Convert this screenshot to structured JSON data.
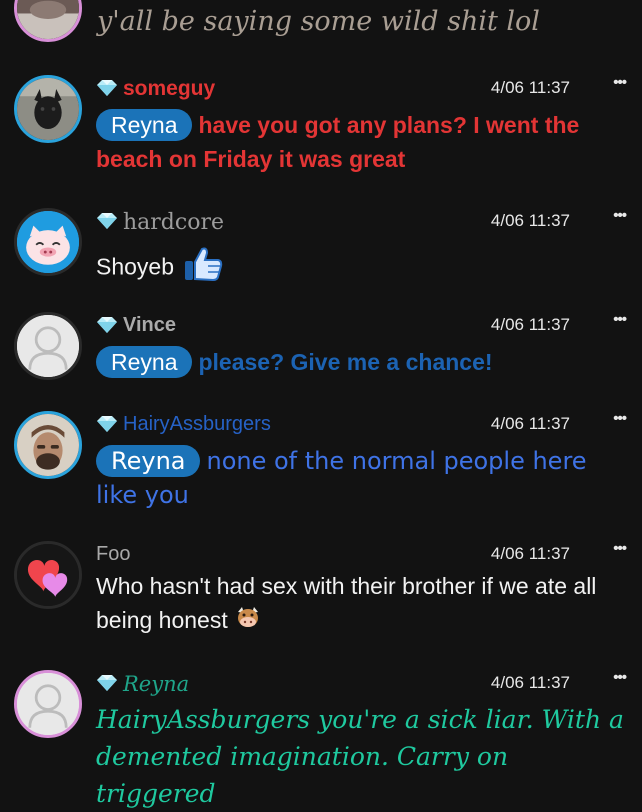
{
  "messages": [
    {
      "id": "prev",
      "text": "y'all be saying some wild shit lol"
    },
    {
      "id": "someguy",
      "username": "someguy",
      "timestamp": "4/06 11:37",
      "mention": "Reyna",
      "text": "have you got any plans? I went the beach on Friday it was great",
      "colors": {
        "name": "#e33535",
        "text": "#e33535"
      }
    },
    {
      "id": "hardcore",
      "username": "hardcore",
      "timestamp": "4/06 11:37",
      "text": "Shoyeb",
      "emoji": "thumbs-up-icon"
    },
    {
      "id": "vince",
      "username": "Vince",
      "timestamp": "4/06 11:37",
      "mention": "Reyna",
      "text": "please? Give me a chance!",
      "colors": {
        "name": "#aaaaaa",
        "text": "#1c63b3"
      }
    },
    {
      "id": "hairy",
      "username": "HairyAssburgers",
      "timestamp": "4/06 11:37",
      "mention": "Reyna",
      "text": "none of the normal people here like you",
      "colors": {
        "name": "#1e56b8",
        "text": "#3f73e6"
      }
    },
    {
      "id": "foo",
      "username": "Foo",
      "timestamp": "4/06 11:37",
      "text": "Who hasn't had sex with their brother if we ate all being honest",
      "emoji": "cow-face-icon"
    },
    {
      "id": "reyna",
      "username": "Reyna",
      "timestamp": "4/06 11:37",
      "text": "HairyAssburgers you're a sick liar. With a demented imagination. Carry on triggered",
      "colors": {
        "name": "#1fa58a",
        "text": "#1fc99f"
      }
    }
  ],
  "menu_glyph": "•••"
}
